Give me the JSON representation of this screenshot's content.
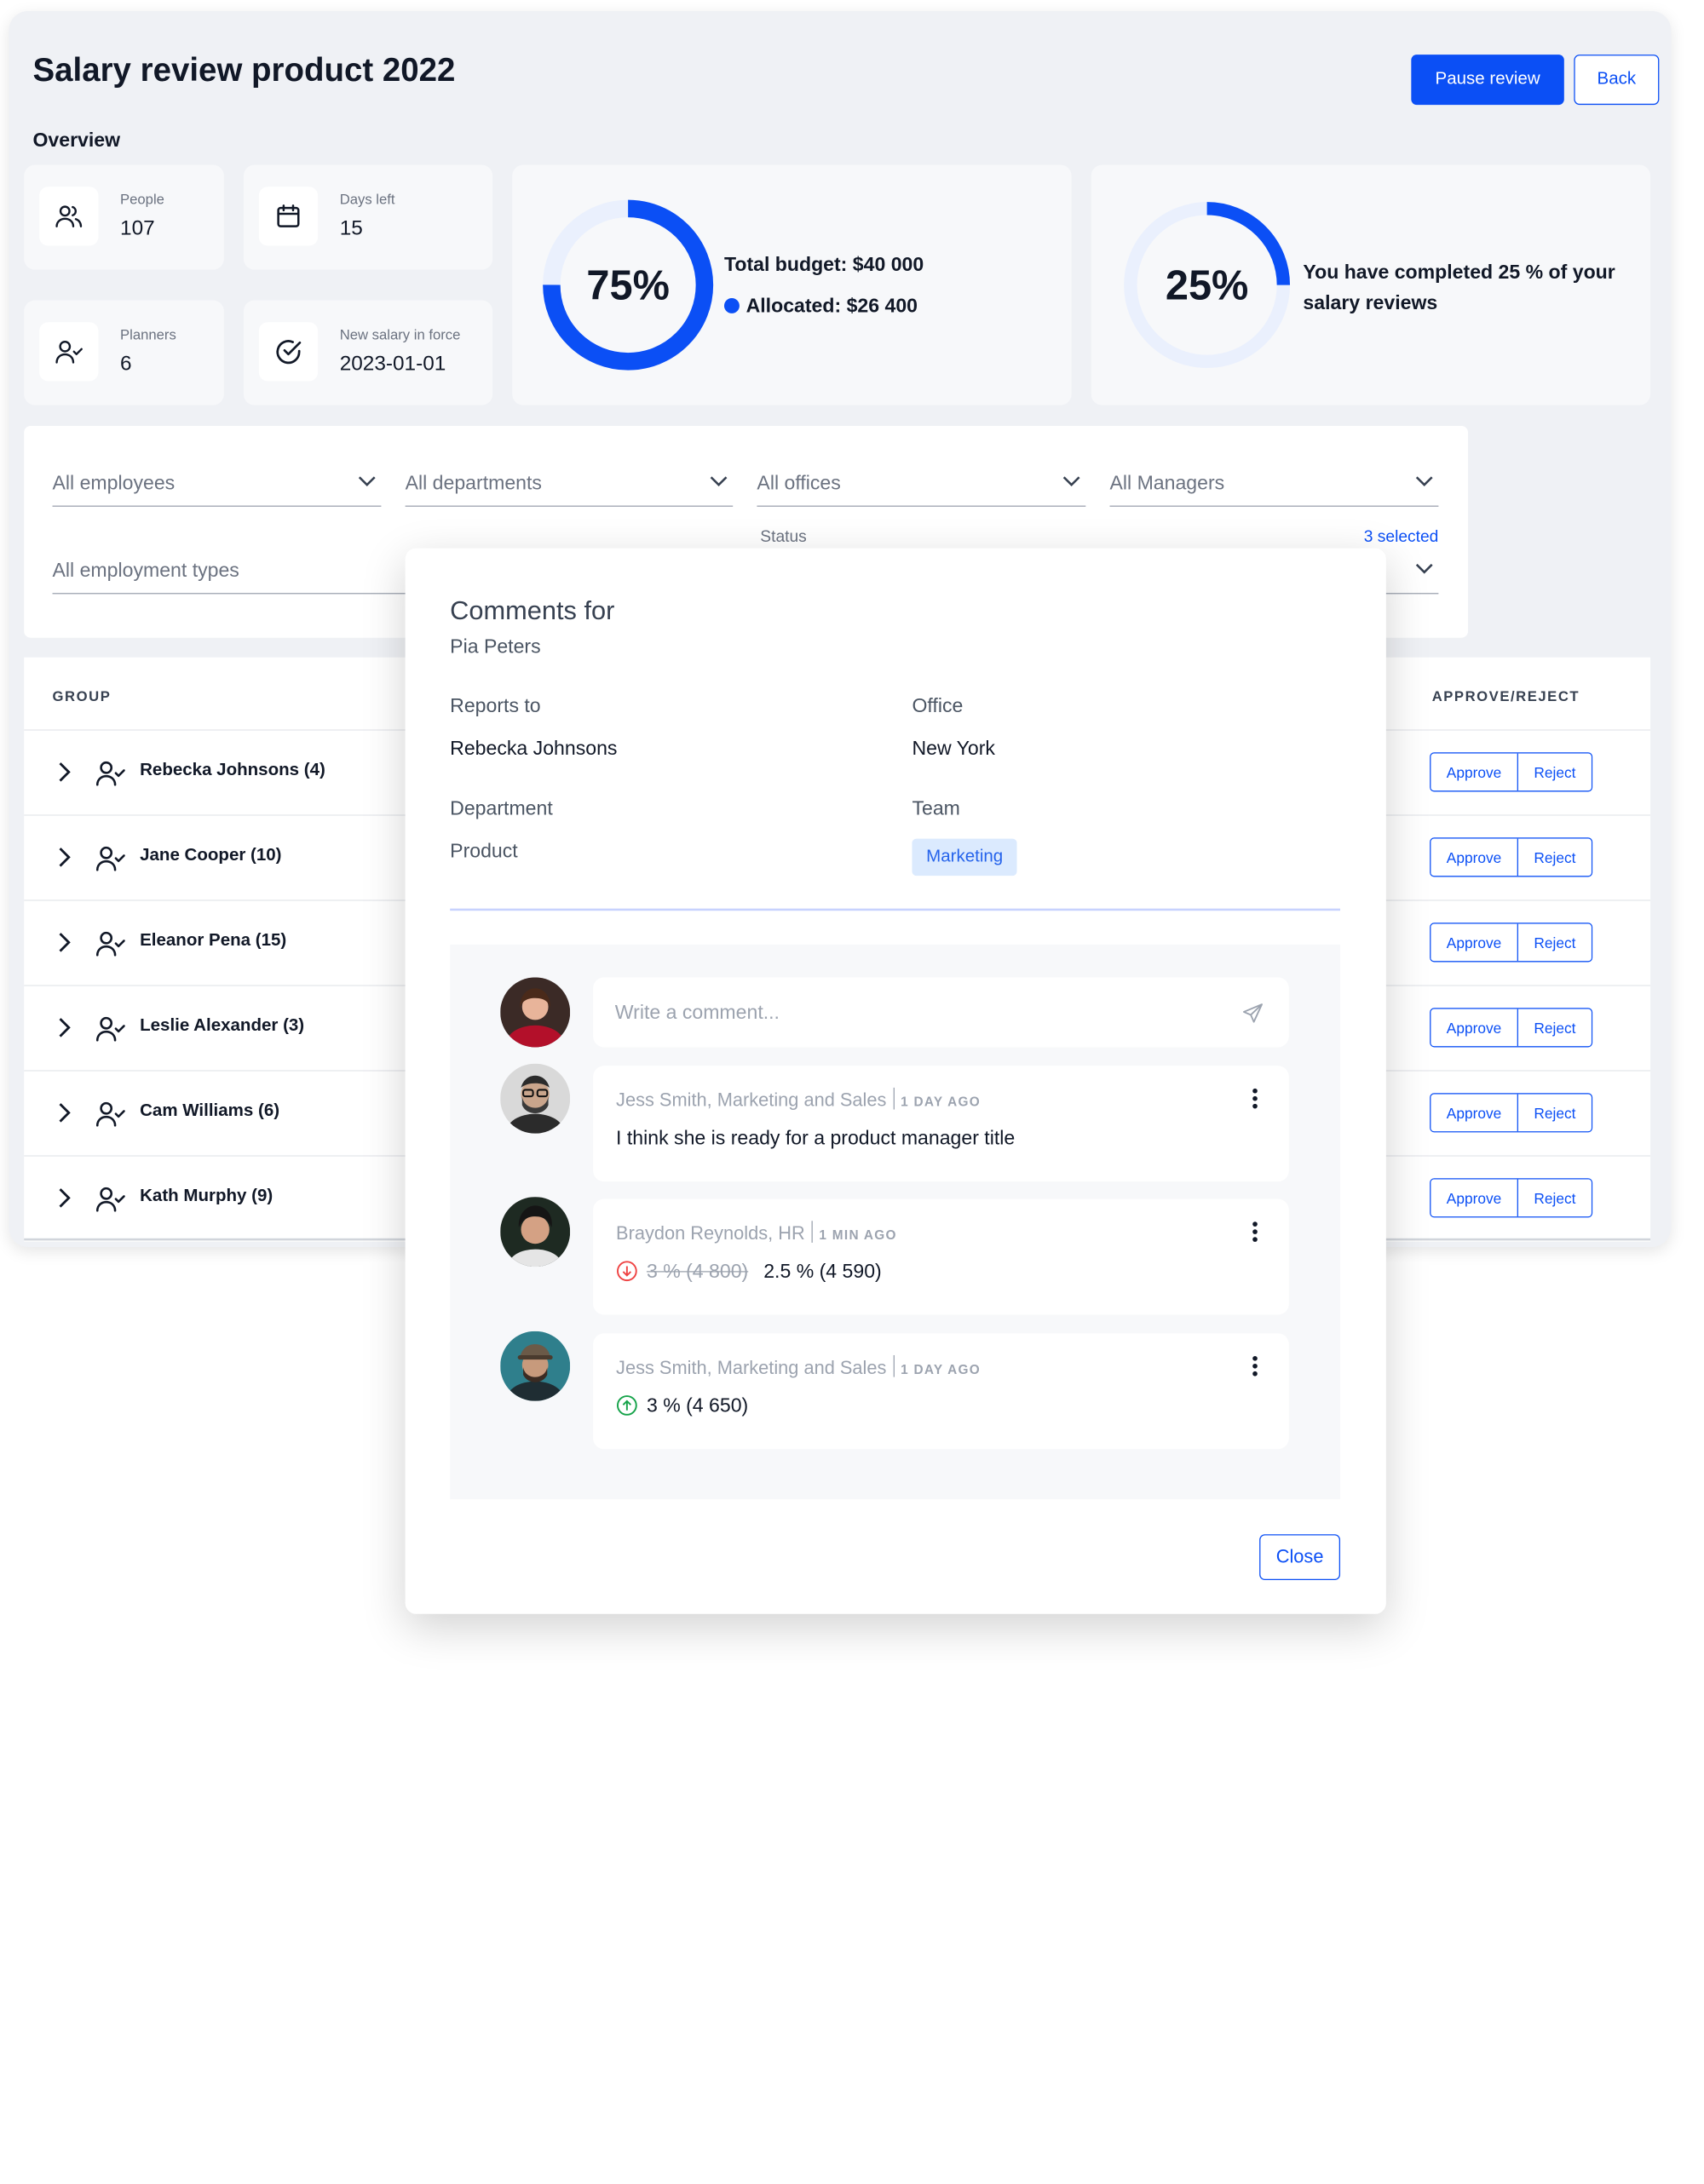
{
  "header": {
    "title": "Salary review product 2022",
    "pause_label": "Pause review",
    "back_label": "Back"
  },
  "overview": {
    "label": "Overview",
    "stats": [
      {
        "label": "People",
        "value": "107",
        "icon": "people-icon"
      },
      {
        "label": "Days left",
        "value": "15",
        "icon": "calendar-icon"
      },
      {
        "label": "Planners",
        "value": "6",
        "icon": "user-check-icon"
      },
      {
        "label": "New salary in force",
        "value": "2023-01-01",
        "icon": "check-circle-icon"
      }
    ],
    "budget": {
      "percent_label": "75%",
      "progress": 0.75,
      "total": "Total budget: $40 000",
      "allocated": "Allocated: $26 400"
    },
    "completion": {
      "percent_label": "25%",
      "progress": 0.25,
      "text": "You have completed 25 % of your salary reviews"
    },
    "accent_color": "#0b4ff5"
  },
  "filters": {
    "employees": "All employees",
    "departments": "All departments",
    "offices": "All offices",
    "managers": "All Managers",
    "employment_types": "All employment types",
    "status_label": "Status",
    "status_selected": "3 selected"
  },
  "table": {
    "col_group": "GROUP",
    "col_approve": "APPROVE/REJECT",
    "approve_label": "Approve",
    "reject_label": "Reject",
    "rows": [
      {
        "name": "Rebecka Johnsons (4)"
      },
      {
        "name": "Jane Cooper (10)"
      },
      {
        "name": "Eleanor Pena (15)"
      },
      {
        "name": "Leslie Alexander (3)"
      },
      {
        "name": "Cam Williams (6)"
      },
      {
        "name": "Kath Murphy (9)"
      }
    ]
  },
  "modal": {
    "title": "Comments for",
    "subject": "Pia Peters",
    "reports_to_label": "Reports to",
    "reports_to": "Rebecka Johnsons",
    "office_label": "Office",
    "office": "New York",
    "department_label": "Department",
    "department": "Product",
    "team_label": "Team",
    "team": "Marketing",
    "comment_placeholder": "Write a comment...",
    "comments": [
      {
        "author": "Jess Smith, Marketing and Sales",
        "ago": "1 DAY AGO",
        "text": "I think she is ready for a product manager title"
      },
      {
        "author": "Braydon Reynolds, HR",
        "ago": "1 MIN AGO",
        "old_value": "3 % (4 800)",
        "new_value": "2.5 % (4 590)",
        "trend": "down"
      },
      {
        "author": "Jess Smith, Marketing and Sales",
        "ago": "1 DAY AGO",
        "new_value": "3 % (4 650)",
        "trend": "up"
      }
    ],
    "close_label": "Close"
  }
}
